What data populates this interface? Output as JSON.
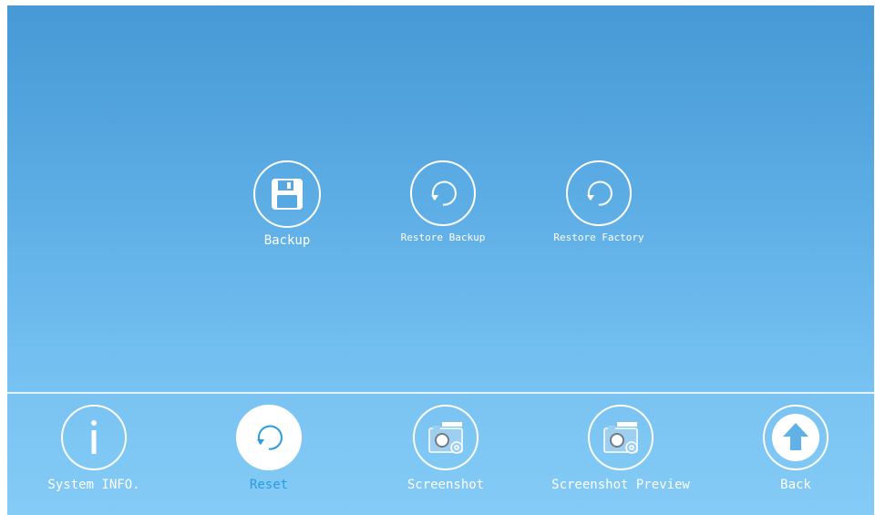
{
  "main_options": [
    {
      "label": "Backup",
      "icon": "floppy-disk-icon"
    },
    {
      "label": "Restore Backup",
      "icon": "restore-icon"
    },
    {
      "label": "Restore Factory",
      "icon": "restore-icon"
    }
  ],
  "nav": [
    {
      "label": "System INFO.",
      "icon": "info-icon",
      "active": false
    },
    {
      "label": "Reset",
      "icon": "reset-icon",
      "active": true
    },
    {
      "label": "Screenshot",
      "icon": "screenshot-icon",
      "active": false
    },
    {
      "label": "Screenshot Preview",
      "icon": "screenshot-preview-icon",
      "active": false
    },
    {
      "label": "Back",
      "icon": "up-arrow-icon",
      "active": false
    }
  ],
  "colors": {
    "background_top": "#4699d5",
    "background_bottom": "#83c9f5",
    "active_label": "#2a9be0",
    "active_fill": "#ffffff"
  }
}
